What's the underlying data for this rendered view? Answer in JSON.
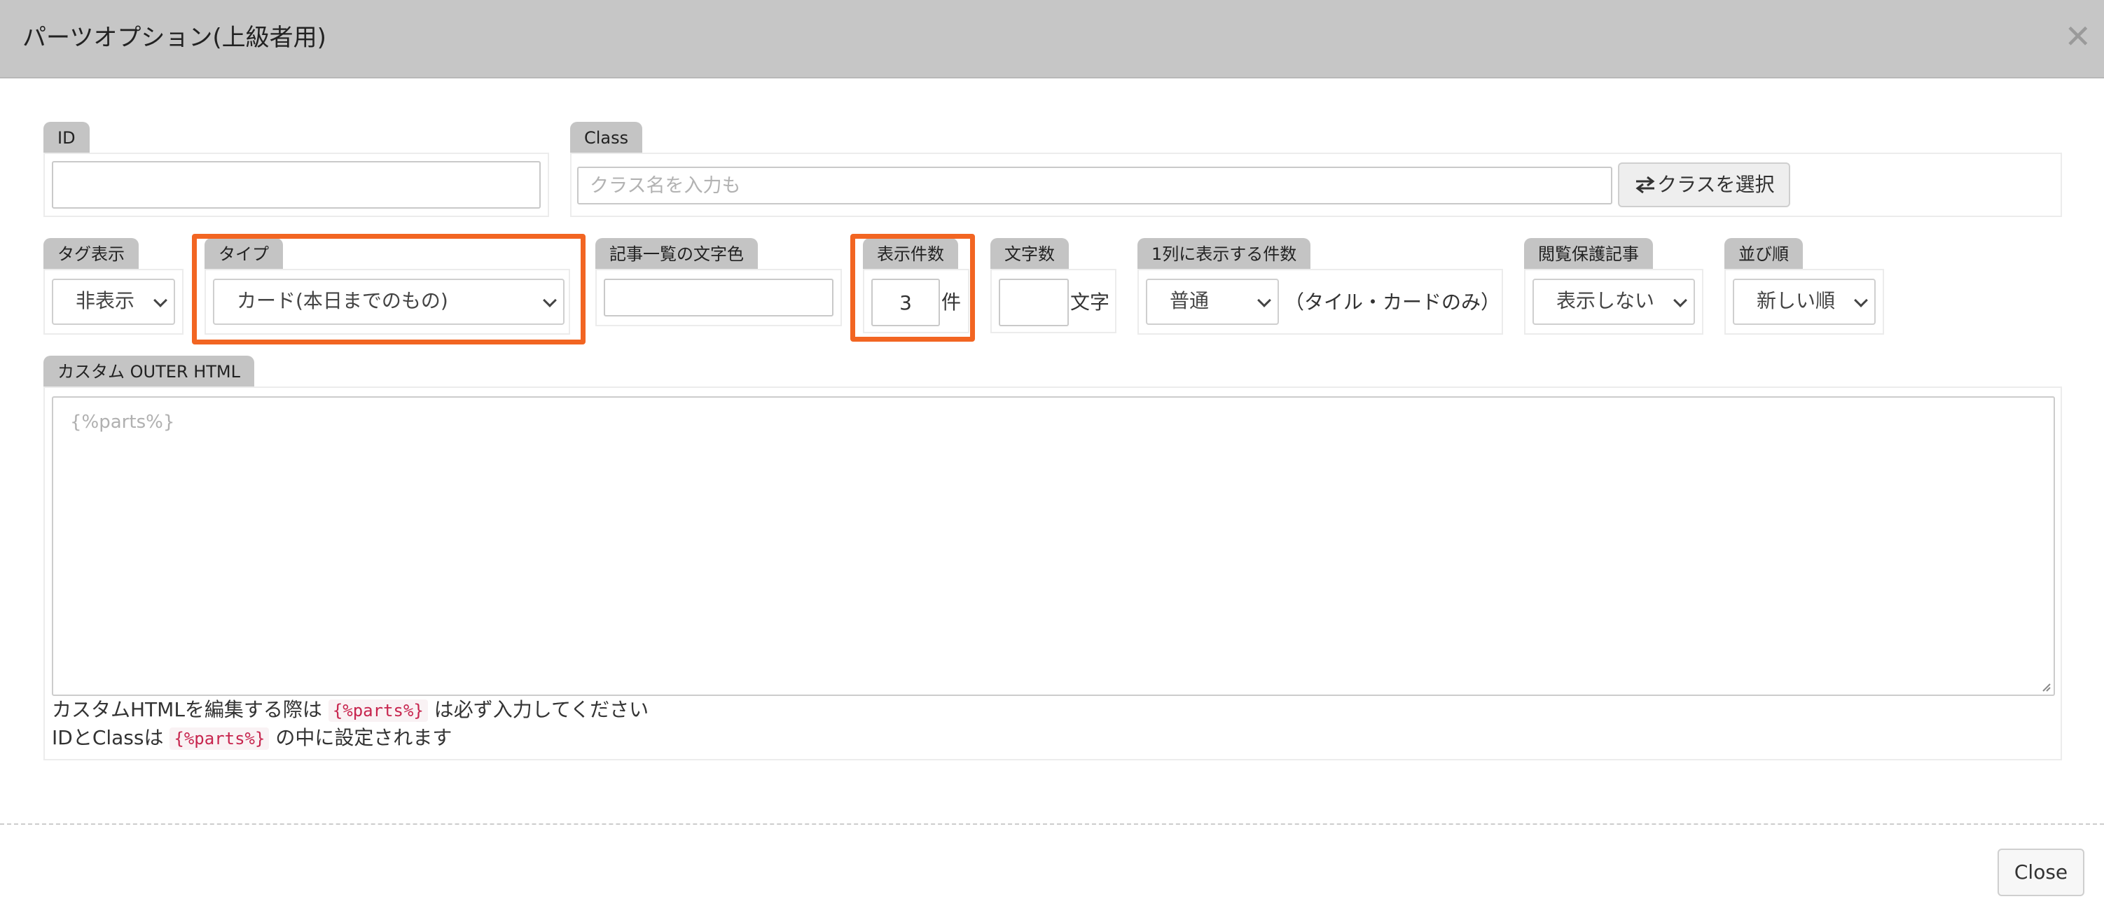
{
  "modal": {
    "title": "パーツオプション(上級者用)",
    "close_icon_glyph": "✕"
  },
  "id_field": {
    "label": "ID",
    "value": ""
  },
  "class_field": {
    "label": "Class",
    "placeholder": "クラス名を入力も",
    "select_button": "クラスを選択"
  },
  "tag_display": {
    "label": "タグ表示",
    "selected": "非表示"
  },
  "type": {
    "label": "タイプ",
    "selected": "カード(本日までのもの)"
  },
  "text_color": {
    "label": "記事一覧の文字色",
    "value": ""
  },
  "item_count": {
    "label": "表示件数",
    "value": "3",
    "unit": "件"
  },
  "char_count": {
    "label": "文字数",
    "value": "",
    "unit": "文字"
  },
  "per_row": {
    "label": "1列に表示する件数",
    "selected": "普通",
    "note": "（タイル・カードのみ）"
  },
  "protected": {
    "label": "閲覧保護記事",
    "selected": "表示しない"
  },
  "sort": {
    "label": "並び順",
    "selected": "新しい順"
  },
  "outer_html": {
    "label": "カスタム OUTER HTML",
    "placeholder": "{%parts%}",
    "help1_before": "カスタムHTMLを編集する際は",
    "help1_code": "{%parts%}",
    "help1_after": "は必ず入力してください",
    "help2_before": "IDとClassは",
    "help2_code": "{%parts%}",
    "help2_after": "の中に設定されます"
  },
  "footer": {
    "close_label": "Close"
  },
  "colors": {
    "highlight": "#f26522",
    "header_bg": "#c6c6c6",
    "code_text": "#c7254e"
  },
  "icons": {
    "swap": "swap-arrows-icon",
    "chevron": "chevron-down-icon",
    "close": "close-icon"
  }
}
